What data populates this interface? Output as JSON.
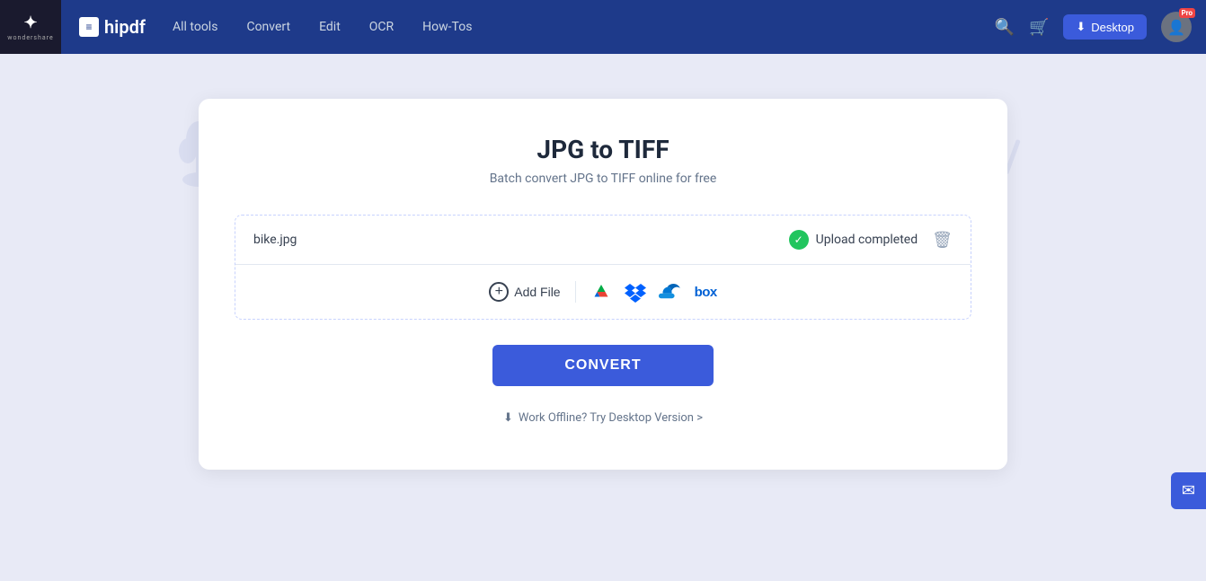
{
  "brand": {
    "ws_logo": "W",
    "ws_sub": "wondershare",
    "hipdf_label": "hipdf"
  },
  "nav": {
    "links": [
      {
        "label": "All tools",
        "key": "all-tools"
      },
      {
        "label": "Convert",
        "key": "convert"
      },
      {
        "label": "Edit",
        "key": "edit"
      },
      {
        "label": "OCR",
        "key": "ocr"
      },
      {
        "label": "How-Tos",
        "key": "how-tos"
      }
    ],
    "desktop_btn": "Desktop",
    "pro_badge": "Pro"
  },
  "page": {
    "title": "JPG to TIFF",
    "subtitle": "Batch convert JPG to TIFF online for free"
  },
  "file": {
    "name": "bike.jpg",
    "status": "Upload completed"
  },
  "toolbar": {
    "add_file_label": "Add File",
    "convert_label": "CONVERT"
  },
  "cloud_services": [
    {
      "name": "Google Drive",
      "key": "gdrive"
    },
    {
      "name": "Dropbox",
      "key": "dropbox"
    },
    {
      "name": "OneDrive",
      "key": "onedrive"
    },
    {
      "name": "Box",
      "key": "box"
    }
  ],
  "offline": {
    "label": "Work Offline? Try Desktop Version >"
  }
}
